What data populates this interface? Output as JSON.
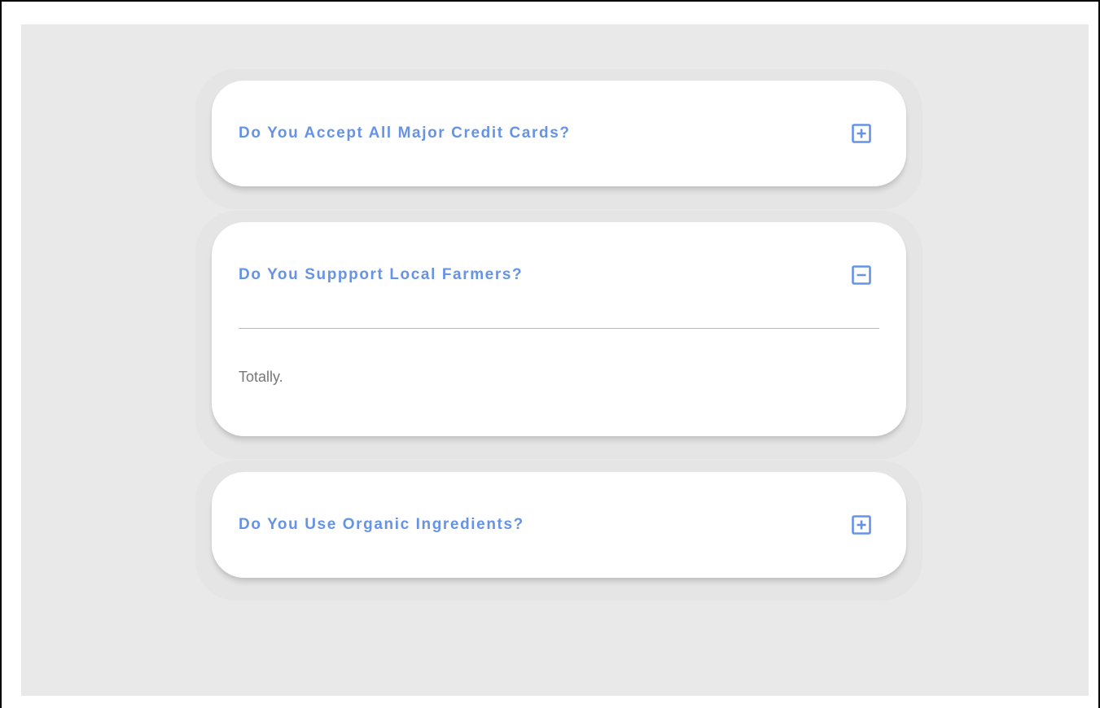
{
  "faq": {
    "items": [
      {
        "question": "Do You Accept All Major Credit Cards?",
        "expanded": false,
        "icon": "plus-square-icon"
      },
      {
        "question": "Do You Suppport Local Farmers?",
        "expanded": true,
        "icon": "minus-square-icon",
        "answer": "Totally."
      },
      {
        "question": "Do You Use Organic Ingredients?",
        "expanded": false,
        "icon": "plus-square-icon"
      }
    ]
  },
  "colors": {
    "accent": "#6693e6",
    "background": "#e9e9e9",
    "card": "#ffffff",
    "answer_text": "#777777"
  }
}
